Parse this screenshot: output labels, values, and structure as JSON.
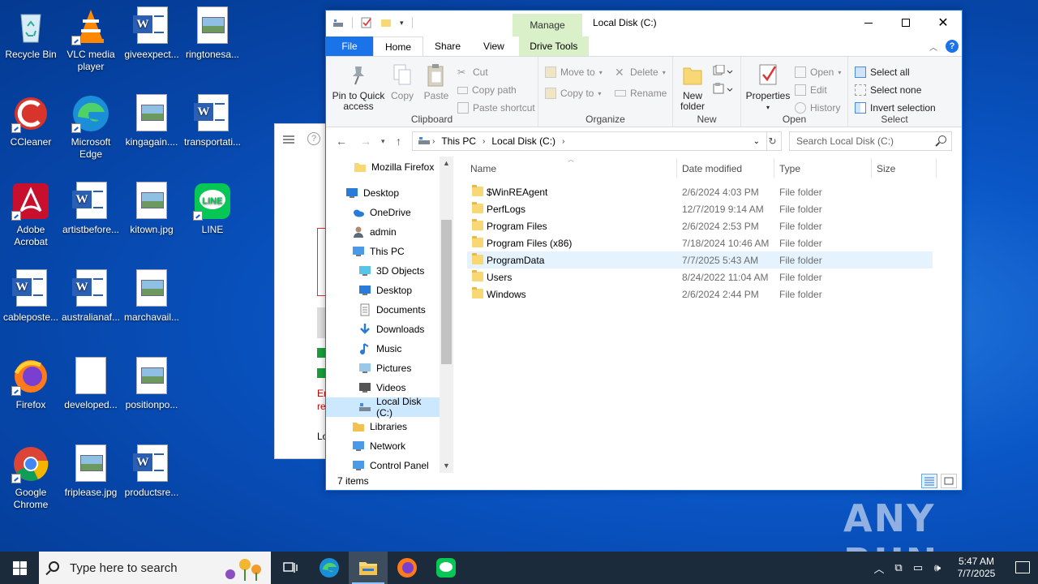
{
  "desktop": {
    "icons": [
      {
        "label": "Recycle Bin",
        "icon": "recycle-bin-icon"
      },
      {
        "label": "VLC media player",
        "icon": "vlc-icon"
      },
      {
        "label": "giveexpect...",
        "icon": "word-doc-icon"
      },
      {
        "label": "ringtonesa...",
        "icon": "image-file-icon"
      },
      {
        "label": "CCleaner",
        "icon": "ccleaner-icon"
      },
      {
        "label": "Microsoft Edge",
        "icon": "edge-icon"
      },
      {
        "label": "kingagain....",
        "icon": "image-file-icon"
      },
      {
        "label": "transportati...",
        "icon": "word-doc-icon"
      },
      {
        "label": "Adobe Acrobat",
        "icon": "acrobat-icon"
      },
      {
        "label": "artistbefore...",
        "icon": "word-doc-icon"
      },
      {
        "label": "kitown.jpg",
        "icon": "image-file-icon"
      },
      {
        "label": "LINE",
        "icon": "line-icon"
      },
      {
        "label": "cableposte...",
        "icon": "word-doc-icon"
      },
      {
        "label": "australianaf...",
        "icon": "word-doc-icon"
      },
      {
        "label": "marchavail...",
        "icon": "image-file-icon"
      },
      {
        "label": "Firefox",
        "icon": "firefox-icon"
      },
      {
        "label": "developed...",
        "icon": "blank-file-icon"
      },
      {
        "label": "positionpo...",
        "icon": "image-file-icon"
      },
      {
        "label": "Google Chrome",
        "icon": "chrome-icon"
      },
      {
        "label": "friplease.jpg",
        "icon": "image-file-icon"
      },
      {
        "label": "productsre...",
        "icon": "word-doc-icon"
      }
    ]
  },
  "bg_dialog": {
    "error_text_1": "Er",
    "error_text_2": "re",
    "bottom_text": "Lo"
  },
  "explorer": {
    "title": "Local Disk (C:)",
    "manage_tab": "Manage",
    "tabs": [
      "File",
      "Home",
      "Share",
      "View",
      "Drive Tools"
    ],
    "ribbon": {
      "clipboard": {
        "name": "Clipboard",
        "pin": "Pin to Quick access",
        "copy": "Copy",
        "paste": "Paste",
        "cut": "Cut",
        "copy_path": "Copy path",
        "paste_shortcut": "Paste shortcut"
      },
      "organize": {
        "name": "Organize",
        "move_to": "Move to",
        "copy_to": "Copy to",
        "delete": "Delete",
        "rename": "Rename"
      },
      "new": {
        "name": "New",
        "new_folder": "New folder"
      },
      "open": {
        "name": "Open",
        "properties": "Properties",
        "open": "Open",
        "edit": "Edit",
        "history": "History"
      },
      "select": {
        "name": "Select",
        "select_all": "Select all",
        "select_none": "Select none",
        "invert": "Invert selection"
      }
    },
    "address": {
      "crumbs": [
        "This PC",
        "Local Disk (C:)"
      ]
    },
    "search_placeholder": "Search Local Disk (C:)",
    "nav": [
      {
        "label": "Mozilla Firefox",
        "icon": "folder-icon"
      },
      {
        "label": "Desktop",
        "icon": "desktop-icon"
      },
      {
        "label": "OneDrive",
        "icon": "onedrive-icon"
      },
      {
        "label": "admin",
        "icon": "user-icon"
      },
      {
        "label": "This PC",
        "icon": "this-pc-icon"
      },
      {
        "label": "3D Objects",
        "icon": "3d-objects-icon"
      },
      {
        "label": "Desktop",
        "icon": "desktop-icon"
      },
      {
        "label": "Documents",
        "icon": "documents-icon"
      },
      {
        "label": "Downloads",
        "icon": "downloads-icon"
      },
      {
        "label": "Music",
        "icon": "music-icon"
      },
      {
        "label": "Pictures",
        "icon": "pictures-icon"
      },
      {
        "label": "Videos",
        "icon": "videos-icon"
      },
      {
        "label": "Local Disk (C:)",
        "icon": "drive-icon"
      },
      {
        "label": "Libraries",
        "icon": "libraries-icon"
      },
      {
        "label": "Network",
        "icon": "network-icon"
      },
      {
        "label": "Control Panel",
        "icon": "control-panel-icon"
      }
    ],
    "columns": {
      "name": "Name",
      "date": "Date modified",
      "type": "Type",
      "size": "Size"
    },
    "files": [
      {
        "name": "$WinREAgent",
        "date": "2/6/2024 4:03 PM",
        "type": "File folder",
        "selected": false
      },
      {
        "name": "PerfLogs",
        "date": "12/7/2019 9:14 AM",
        "type": "File folder",
        "selected": false
      },
      {
        "name": "Program Files",
        "date": "2/6/2024 2:53 PM",
        "type": "File folder",
        "selected": false
      },
      {
        "name": "Program Files (x86)",
        "date": "7/18/2024 10:46 AM",
        "type": "File folder",
        "selected": false
      },
      {
        "name": "ProgramData",
        "date": "7/7/2025 5:43 AM",
        "type": "File folder",
        "selected": true
      },
      {
        "name": "Users",
        "date": "8/24/2022 11:04 AM",
        "type": "File folder",
        "selected": false
      },
      {
        "name": "Windows",
        "date": "2/6/2024 2:44 PM",
        "type": "File folder",
        "selected": false
      }
    ],
    "status": "7 items"
  },
  "watermark": "ANY RUN",
  "taskbar": {
    "search_placeholder": "Type here to search",
    "time": "5:47 AM",
    "date": "7/7/2025"
  },
  "colors": {
    "accent": "#1a73e8",
    "manage_tab": "#d9f0c9",
    "selection": "#cce8ff",
    "taskbar": "#1c2b3b"
  }
}
